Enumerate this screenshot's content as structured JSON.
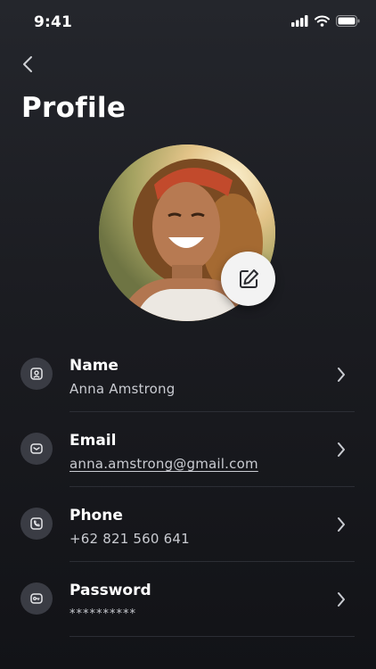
{
  "status_bar": {
    "time": "9:41"
  },
  "header": {
    "title": "Profile"
  },
  "fields": [
    {
      "label": "Name",
      "value": "Anna Amstrong",
      "icon": "user-icon"
    },
    {
      "label": "Email",
      "value": "anna.amstrong@gmail.com",
      "icon": "mail-icon"
    },
    {
      "label": "Phone",
      "value": "+62 821 560 641",
      "icon": "phone-icon"
    },
    {
      "label": "Password",
      "value": "**********",
      "icon": "key-icon"
    }
  ],
  "colors": {
    "background": "#1b1c21",
    "icon_bg": "#3a3c44",
    "secondary_text": "#c9cbd1"
  }
}
